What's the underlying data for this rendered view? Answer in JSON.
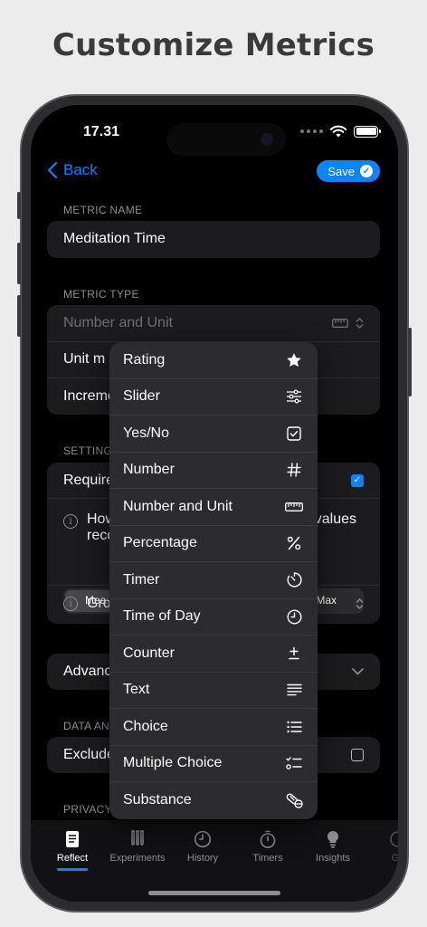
{
  "headline": "Customize Metrics",
  "status": {
    "time": "17.31"
  },
  "nav": {
    "back_label": "Back",
    "save_label": "Save"
  },
  "metric_name": {
    "section": "METRIC NAME",
    "value": "Meditation Time"
  },
  "metric_type": {
    "section": "METRIC TYPE",
    "selected": "Number and Unit",
    "unit_row": "Unit m",
    "increment_row": "Increme"
  },
  "settings": {
    "section": "SETTING",
    "required_label": "Require",
    "info1_text_a": "How",
    "info1_text_b": "reco",
    "info1_text_right": "values",
    "seg_left": "Mea",
    "seg_right": "Max",
    "group_label": "Gro"
  },
  "advanced": {
    "label": "Advanc"
  },
  "data_section": {
    "section": "DATA AN",
    "exclude_label": "Exclude"
  },
  "privacy_section": {
    "section": "PRIVACY"
  },
  "menu": {
    "items": [
      {
        "label": "Rating",
        "icon": "star-icon"
      },
      {
        "label": "Slider",
        "icon": "sliders-icon"
      },
      {
        "label": "Yes/No",
        "icon": "checkbox-icon"
      },
      {
        "label": "Number",
        "icon": "hash-icon"
      },
      {
        "label": "Number and Unit",
        "icon": "ruler-icon"
      },
      {
        "label": "Percentage",
        "icon": "percent-icon"
      },
      {
        "label": "Timer",
        "icon": "timer-icon"
      },
      {
        "label": "Time of Day",
        "icon": "clock-icon"
      },
      {
        "label": "Counter",
        "icon": "plus-minus-icon"
      },
      {
        "label": "Text",
        "icon": "text-align-icon"
      },
      {
        "label": "Choice",
        "icon": "list-icon"
      },
      {
        "label": "Multiple Choice",
        "icon": "checklist-icon"
      },
      {
        "label": "Substance",
        "icon": "pills-icon"
      }
    ]
  },
  "tabs": [
    {
      "label": "Reflect",
      "icon": "journal-icon",
      "active": true
    },
    {
      "label": "Experiments",
      "icon": "test-tubes-icon"
    },
    {
      "label": "History",
      "icon": "clock-icon"
    },
    {
      "label": "Timers",
      "icon": "stopwatch-icon"
    },
    {
      "label": "Insights",
      "icon": "lightbulb-icon"
    },
    {
      "label": "Ga",
      "icon": "goals-icon"
    }
  ],
  "colors": {
    "accent": "#0a84ff",
    "background": "#000000",
    "card": "#1c1c1e",
    "menu": "#2c2c2e"
  }
}
